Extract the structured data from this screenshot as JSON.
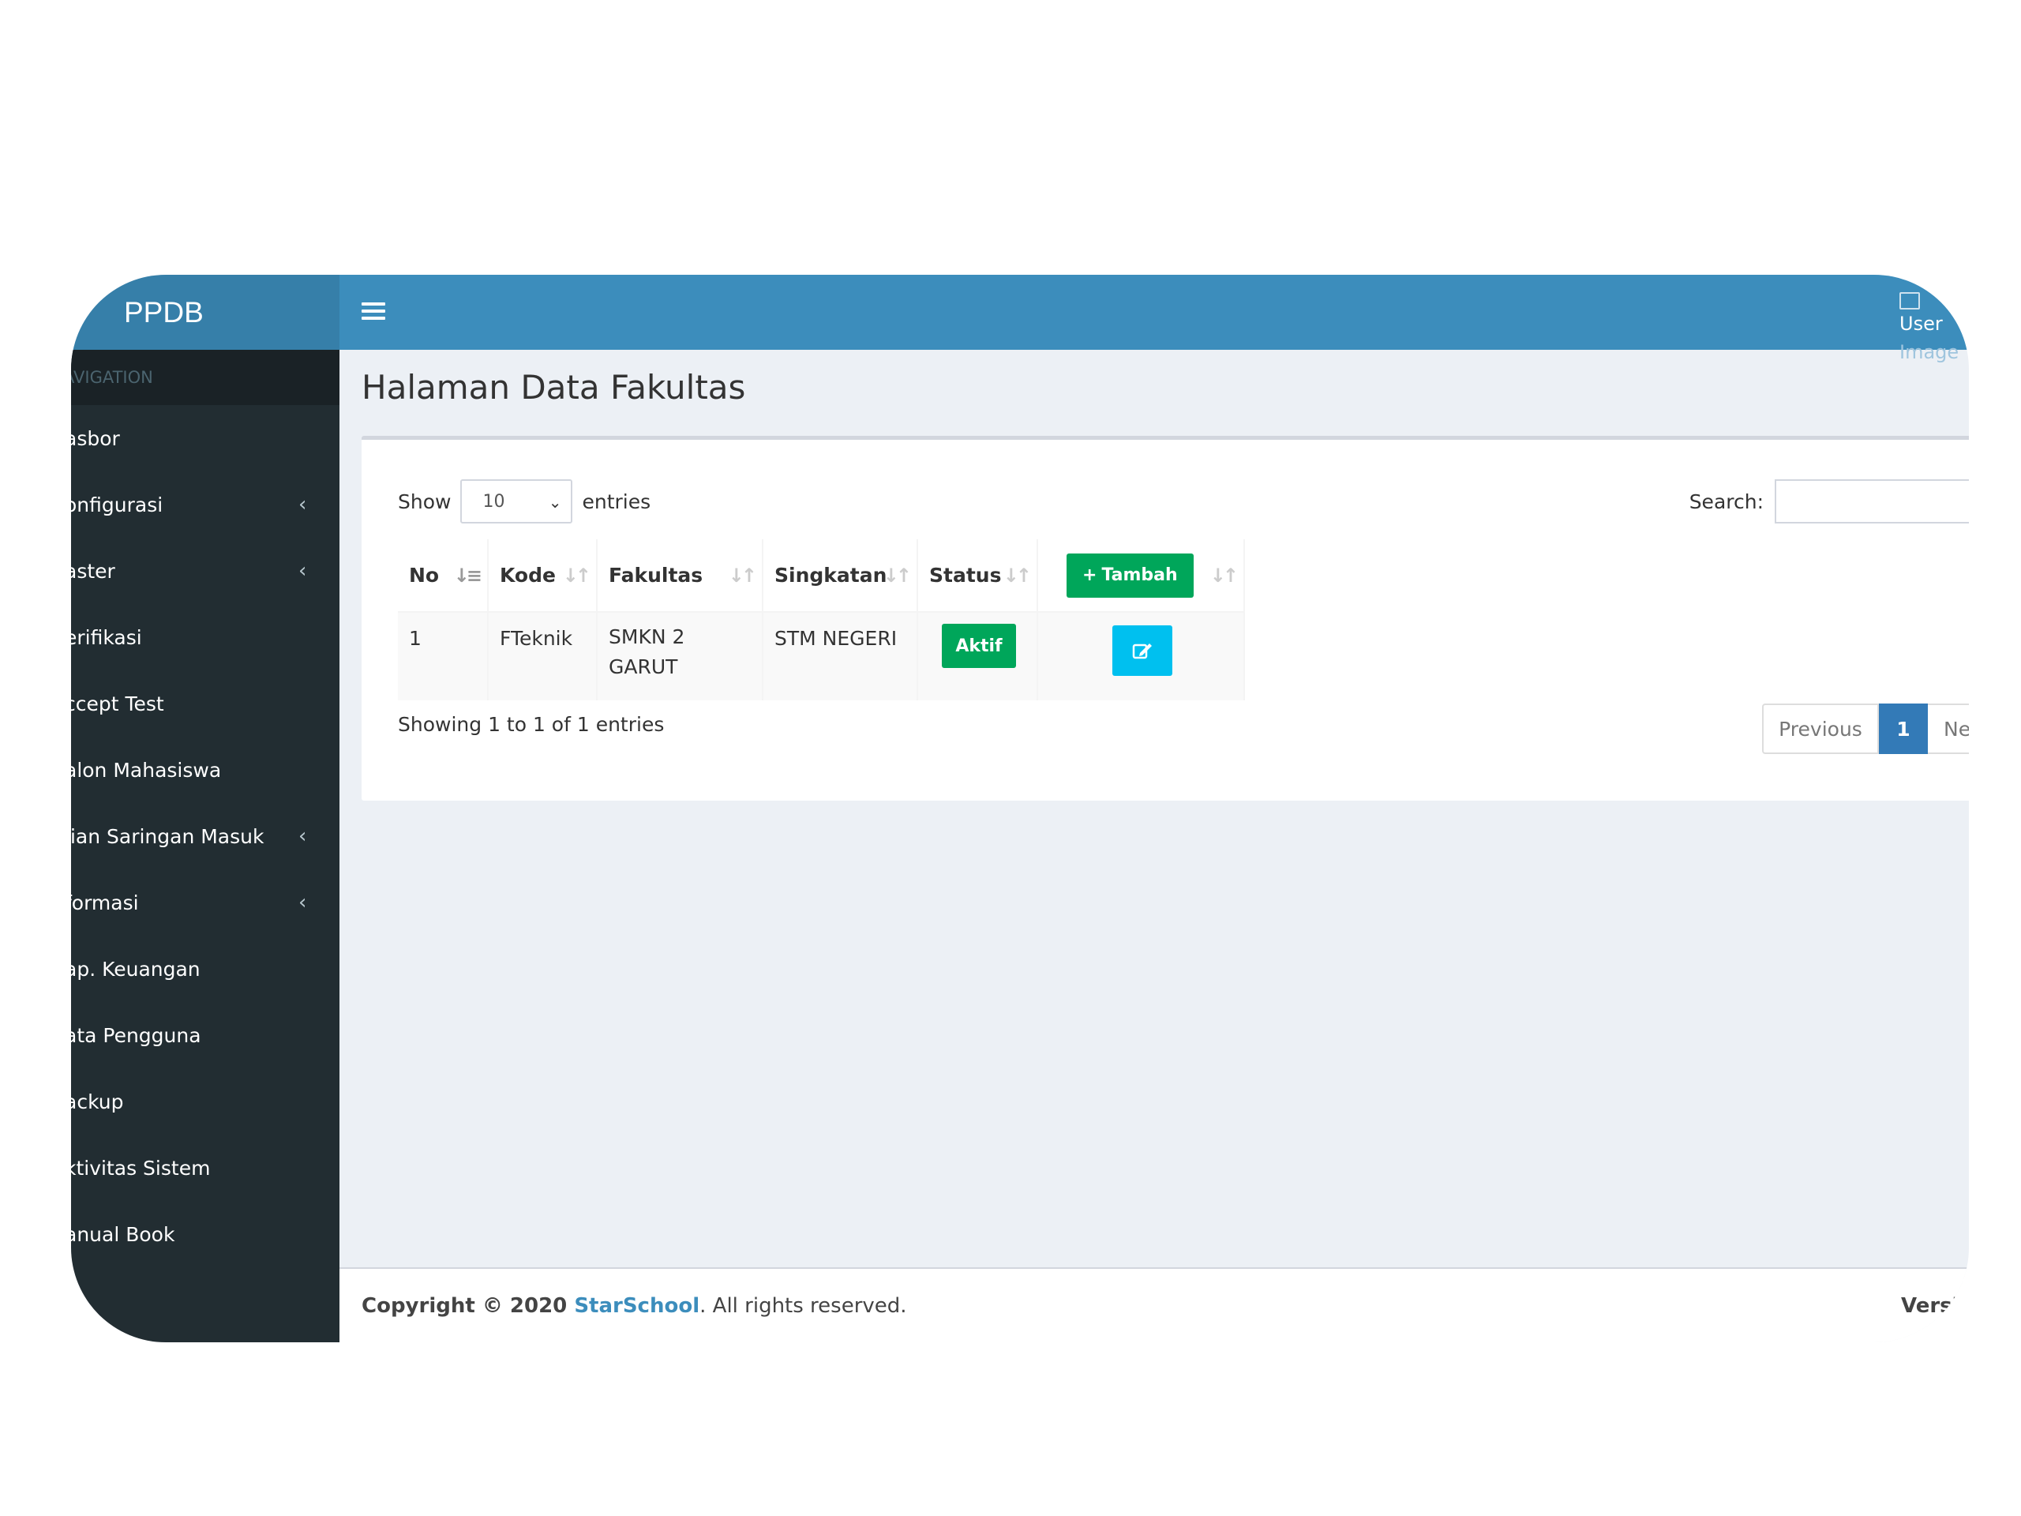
{
  "app": {
    "logo": "PPDB"
  },
  "header": {
    "user_image_alt_line1": "User",
    "user_image_alt_line2": "Image"
  },
  "sidebar": {
    "header": "AVIGATION",
    "items": [
      {
        "label": "asbor",
        "has_children": false
      },
      {
        "label": "onfigurasi",
        "has_children": true
      },
      {
        "label": "aster",
        "has_children": true
      },
      {
        "label": "erifikasi",
        "has_children": false
      },
      {
        "label": "ccept Test",
        "has_children": false
      },
      {
        "label": "alon Mahasiswa",
        "has_children": false
      },
      {
        "label": "jian Saringan Masuk",
        "has_children": true
      },
      {
        "label": "formasi",
        "has_children": true
      },
      {
        "label": "ap. Keuangan",
        "has_children": false
      },
      {
        "label": "ata Pengguna",
        "has_children": false
      },
      {
        "label": "ackup",
        "has_children": false
      },
      {
        "label": "ktivitas Sistem",
        "has_children": false
      },
      {
        "label": "anual Book",
        "has_children": false
      }
    ],
    "chevron": "‹"
  },
  "page": {
    "title": "Halaman Data Fakultas"
  },
  "table_controls": {
    "show_label": "Show",
    "entries_value": "10",
    "entries_label": "entries",
    "search_label": "Search:",
    "search_value": ""
  },
  "table": {
    "columns": [
      "No",
      "Kode",
      "Fakultas",
      "Singkatan",
      "Status"
    ],
    "add_button": "Tambah",
    "rows": [
      {
        "no": "1",
        "kode": "FTeknik",
        "fakultas_line1": "SMKN 2",
        "fakultas_line2": "GARUT",
        "singkatan": "STM NEGERI",
        "status": "Aktif"
      }
    ]
  },
  "pagination": {
    "info": "Showing 1 to 1 of 1 entries",
    "previous": "Previous",
    "current": "1",
    "next": "Next"
  },
  "footer": {
    "copyright": "Copyright © 2020 ",
    "brand": "StarSchool",
    "rights": ". All rights reserved.",
    "version": "Version"
  },
  "colors": {
    "header": "#3c8dbc",
    "logo_bg": "#367fa9",
    "sidebar": "#222d32",
    "success": "#00a65a",
    "info": "#00c0ef",
    "primary": "#337ab7"
  }
}
